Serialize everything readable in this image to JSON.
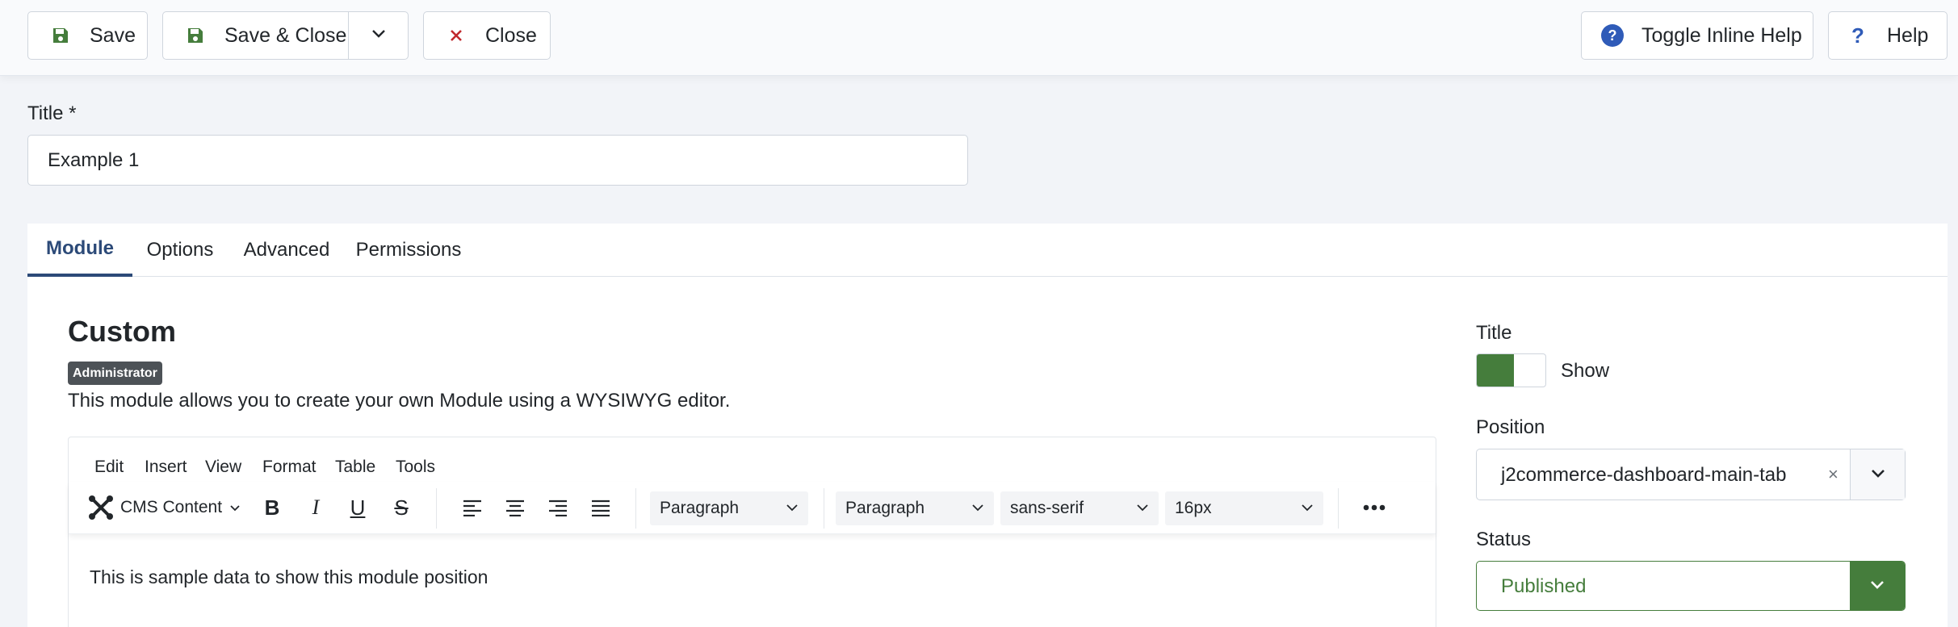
{
  "toolbar": {
    "save_label": "Save",
    "save_close_label": "Save & Close",
    "close_label": "Close",
    "toggle_help_label": "Toggle Inline Help",
    "help_label": "Help"
  },
  "title_field": {
    "label": "Title *",
    "value": "Example 1"
  },
  "tabs": [
    {
      "label": "Module",
      "active": true
    },
    {
      "label": "Options",
      "active": false
    },
    {
      "label": "Advanced",
      "active": false
    },
    {
      "label": "Permissions",
      "active": false
    }
  ],
  "module": {
    "heading": "Custom",
    "badge": "Administrator",
    "description": "This module allows you to create your own Module using a WYSIWYG editor."
  },
  "editor": {
    "menu": [
      "Edit",
      "Insert",
      "View",
      "Format",
      "Table",
      "Tools"
    ],
    "cms_content_label": "CMS Content",
    "block_format_1": "Paragraph",
    "block_format_2": "Paragraph",
    "font_family": "sans-serif",
    "font_size": "16px",
    "content": "This is sample data to show this module position"
  },
  "sidebar": {
    "title_label": "Title",
    "title_toggle_label": "Show",
    "title_toggle_on": true,
    "position_label": "Position",
    "position_value": "j2commerce-dashboard-main-tab",
    "position_clear": "×",
    "status_label": "Status",
    "status_value": "Published"
  },
  "colors": {
    "accent_green": "#457d3c",
    "tab_active": "#2c4a78",
    "close_red": "#c0282d",
    "help_blue": "#2f5bb8"
  }
}
